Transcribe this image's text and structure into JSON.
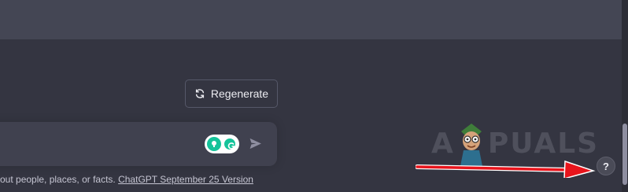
{
  "regenerate": {
    "label": "Regenerate",
    "icon": "refresh-icon"
  },
  "composer": {
    "extension_icons": [
      "grammarly-tip-icon",
      "grammarly-icon"
    ],
    "extension_color": "#15c39a",
    "send_icon": "send-icon"
  },
  "footer": {
    "disclaimer_text": "out people, places, or facts. ",
    "version_link": "ChatGPT September 25 Version"
  },
  "watermark": {
    "text_left": "A",
    "text_right": "PUALS"
  },
  "help_button": {
    "label": "?"
  },
  "annotation": {
    "arrow_color": "#e8141c"
  },
  "colors": {
    "background": "#343541",
    "panel": "#444654",
    "input": "#40414f"
  }
}
